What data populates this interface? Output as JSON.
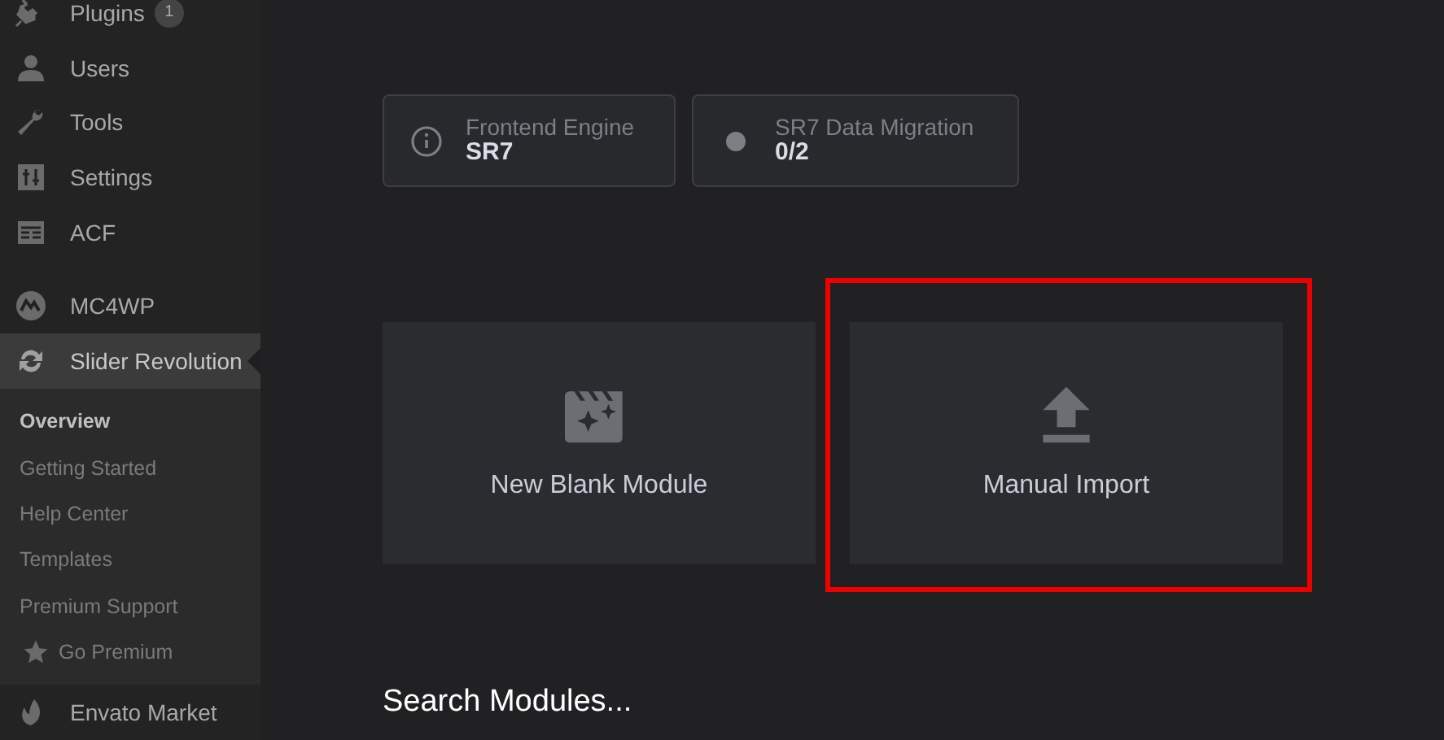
{
  "sidebar": {
    "items": [
      {
        "kind": "plugin",
        "label": "Plugins",
        "badge": "1",
        "selected": false
      },
      {
        "kind": "user",
        "label": "Users",
        "selected": false
      },
      {
        "kind": "wrench",
        "label": "Tools",
        "selected": false
      },
      {
        "kind": "sliders",
        "label": "Settings",
        "selected": false
      },
      {
        "kind": "table",
        "label": "ACF",
        "selected": false
      },
      {
        "kind": "mail",
        "label": "MC4WP",
        "selected": false,
        "gap": true
      },
      {
        "kind": "refresh",
        "label": "Slider Revolution",
        "selected": true,
        "children": [
          {
            "label": "Overview",
            "selected": true
          },
          {
            "label": "Getting Started",
            "selected": false
          },
          {
            "label": "Help Center",
            "selected": false
          },
          {
            "label": "Templates",
            "selected": false
          },
          {
            "label": "Premium Support",
            "selected": false
          },
          {
            "label": "Go Premium",
            "selected": false,
            "star": true
          }
        ]
      },
      {
        "kind": "leaf",
        "label": "Envato Market",
        "selected": false
      }
    ]
  },
  "status_cards": [
    {
      "kind": "info",
      "label": "Frontend Engine",
      "value": "SR7"
    },
    {
      "kind": "dot",
      "label": "SR7 Data Migration",
      "value": "0/2"
    }
  ],
  "action_cards": [
    {
      "kind": "clapper",
      "label": "New Blank Module",
      "highlighted": false
    },
    {
      "kind": "upload",
      "label": "Manual Import",
      "highlighted": true
    }
  ],
  "search_heading": "Search Modules..."
}
